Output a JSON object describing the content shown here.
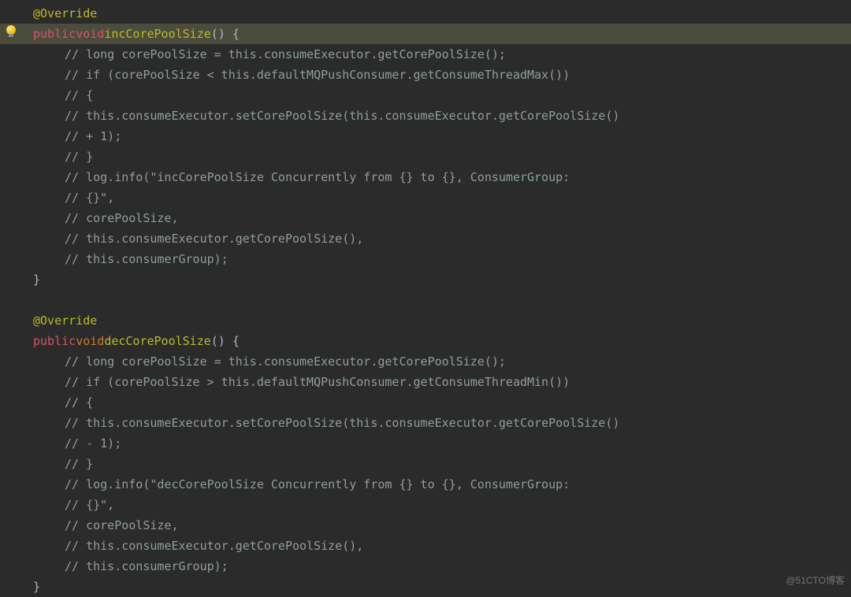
{
  "lines": [
    {
      "indent": 0,
      "hl": false,
      "segs": [
        {
          "t": "@Override",
          "c": "annotation"
        }
      ]
    },
    {
      "indent": 0,
      "hl": true,
      "segs": [
        {
          "t": "public",
          "c": "keyword"
        },
        {
          "t": " ",
          "c": "punct"
        },
        {
          "t": "void",
          "c": "keyword"
        },
        {
          "t": " ",
          "c": "punct"
        },
        {
          "t": "incCorePoolSize",
          "c": "method"
        },
        {
          "t": "() {",
          "c": "punct"
        }
      ]
    },
    {
      "indent": 1,
      "hl": false,
      "segs": [
        {
          "t": "// long corePoolSize = this.consumeExecutor.getCorePoolSize();",
          "c": "comment"
        }
      ]
    },
    {
      "indent": 1,
      "hl": false,
      "segs": [
        {
          "t": "// if (corePoolSize < this.defaultMQPushConsumer.getConsumeThreadMax())",
          "c": "comment"
        }
      ]
    },
    {
      "indent": 1,
      "hl": false,
      "segs": [
        {
          "t": "// {",
          "c": "comment"
        }
      ]
    },
    {
      "indent": 1,
      "hl": false,
      "segs": [
        {
          "t": "// this.consumeExecutor.setCorePoolSize(this.consumeExecutor.getCorePoolSize()",
          "c": "comment"
        }
      ]
    },
    {
      "indent": 1,
      "hl": false,
      "segs": [
        {
          "t": "// + 1);",
          "c": "comment"
        }
      ]
    },
    {
      "indent": 1,
      "hl": false,
      "segs": [
        {
          "t": "// }",
          "c": "comment"
        }
      ]
    },
    {
      "indent": 1,
      "hl": false,
      "segs": [
        {
          "t": "// log.info(\"incCorePoolSize Concurrently from {} to {}, ConsumerGroup:",
          "c": "comment"
        }
      ]
    },
    {
      "indent": 1,
      "hl": false,
      "segs": [
        {
          "t": "// {}\",",
          "c": "comment"
        }
      ]
    },
    {
      "indent": 1,
      "hl": false,
      "segs": [
        {
          "t": "// corePoolSize,",
          "c": "comment"
        }
      ]
    },
    {
      "indent": 1,
      "hl": false,
      "segs": [
        {
          "t": "// this.consumeExecutor.getCorePoolSize(),",
          "c": "comment"
        }
      ]
    },
    {
      "indent": 1,
      "hl": false,
      "segs": [
        {
          "t": "// this.consumerGroup);",
          "c": "comment"
        }
      ]
    },
    {
      "indent": 0,
      "hl": false,
      "segs": [
        {
          "t": "}",
          "c": "punct"
        }
      ]
    },
    {
      "indent": 0,
      "hl": false,
      "segs": [
        {
          "t": "",
          "c": "punct"
        }
      ]
    },
    {
      "indent": 0,
      "hl": false,
      "segs": [
        {
          "t": "@Override",
          "c": "annotation"
        }
      ]
    },
    {
      "indent": 0,
      "hl": false,
      "segs": [
        {
          "t": "public",
          "c": "keyword"
        },
        {
          "t": " ",
          "c": "punct"
        },
        {
          "t": "void",
          "c": "type"
        },
        {
          "t": " ",
          "c": "punct"
        },
        {
          "t": "decCorePoolSize",
          "c": "method"
        },
        {
          "t": "() {",
          "c": "punct"
        }
      ]
    },
    {
      "indent": 1,
      "hl": false,
      "segs": [
        {
          "t": "// long corePoolSize = this.consumeExecutor.getCorePoolSize();",
          "c": "comment"
        }
      ]
    },
    {
      "indent": 1,
      "hl": false,
      "segs": [
        {
          "t": "// if (corePoolSize > this.defaultMQPushConsumer.getConsumeThreadMin())",
          "c": "comment"
        }
      ]
    },
    {
      "indent": 1,
      "hl": false,
      "segs": [
        {
          "t": "// {",
          "c": "comment"
        }
      ]
    },
    {
      "indent": 1,
      "hl": false,
      "segs": [
        {
          "t": "// this.consumeExecutor.setCorePoolSize(this.consumeExecutor.getCorePoolSize()",
          "c": "comment"
        }
      ]
    },
    {
      "indent": 1,
      "hl": false,
      "segs": [
        {
          "t": "// - 1);",
          "c": "comment"
        }
      ]
    },
    {
      "indent": 1,
      "hl": false,
      "segs": [
        {
          "t": "// }",
          "c": "comment"
        }
      ]
    },
    {
      "indent": 1,
      "hl": false,
      "segs": [
        {
          "t": "// log.info(\"decCorePoolSize Concurrently from {} to {}, ConsumerGroup:",
          "c": "comment"
        }
      ]
    },
    {
      "indent": 1,
      "hl": false,
      "segs": [
        {
          "t": "// {}\",",
          "c": "comment"
        }
      ]
    },
    {
      "indent": 1,
      "hl": false,
      "segs": [
        {
          "t": "// corePoolSize,",
          "c": "comment"
        }
      ]
    },
    {
      "indent": 1,
      "hl": false,
      "segs": [
        {
          "t": "// this.consumeExecutor.getCorePoolSize(),",
          "c": "comment"
        }
      ]
    },
    {
      "indent": 1,
      "hl": false,
      "segs": [
        {
          "t": "// this.consumerGroup);",
          "c": "comment"
        }
      ]
    },
    {
      "indent": 0,
      "hl": false,
      "segs": [
        {
          "t": "}",
          "c": "punct"
        }
      ]
    }
  ],
  "watermark": "@51CTO博客"
}
